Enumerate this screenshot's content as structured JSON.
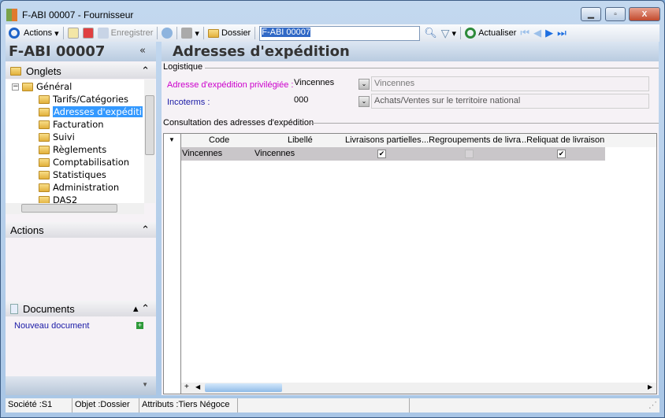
{
  "window": {
    "title": "F-ABI 00007 -  Fournisseur",
    "minimize": "▁",
    "maximize": "▫",
    "close": "X"
  },
  "toolbar": {
    "actions": "Actions",
    "save": "Enregistrer",
    "folder": "Dossier",
    "search_value": "F-ABI 00007",
    "refresh": "Actualiser"
  },
  "left": {
    "record": "F-ABI 00007",
    "collapse": "«",
    "tabs_title": "Onglets",
    "tree_root": "Général",
    "tree_items": [
      "Tarifs/Catégories",
      "Adresses d'expéditi",
      "Facturation",
      "Suivi",
      "Règlements",
      "Comptabilisation",
      "Statistiques",
      "Administration",
      "DAS2"
    ],
    "actions_title": "Actions",
    "documents_title": "Documents",
    "new_document": "Nouveau document"
  },
  "main": {
    "title": "Adresses d'expédition",
    "group1": "Logistique",
    "fields": [
      {
        "label": "Adresse d'expédition privilégiée :",
        "value": "Vincennes",
        "desc": "Vincennes",
        "color": "#cc00cc"
      },
      {
        "label": "Incoterms :",
        "value": "000",
        "desc": "Achats/Ventes sur le territoire national",
        "color": "#1a1aa6"
      }
    ],
    "group2": "Consultation des adresses d'expédition",
    "columns": [
      "Code",
      "Libellé",
      "Livraisons partielles",
      "...Regroupements de livra",
      "...Reliquat de livraison"
    ],
    "rows": [
      {
        "code": "Vincennes",
        "libelle": "Vincennes",
        "partielles": true,
        "regroupements": false,
        "reliquat": true
      }
    ]
  },
  "status": {
    "societe": "Société :S1",
    "objet": "Objet :Dossier",
    "attributs": "Attributs :Tiers Négoce"
  }
}
